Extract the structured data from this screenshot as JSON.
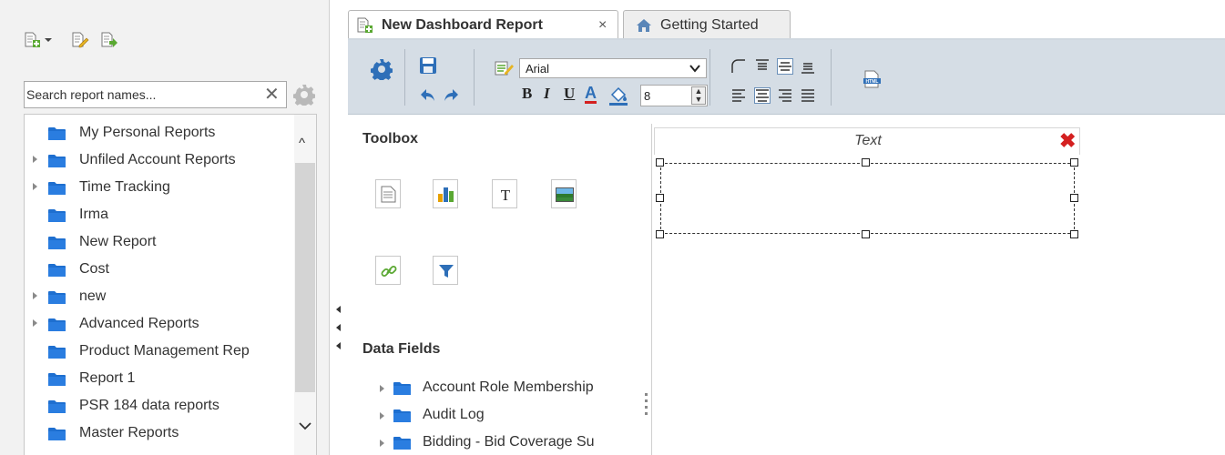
{
  "left_panel": {
    "search": {
      "placeholder": "Search report names...",
      "clear_glyph": "✕"
    },
    "toolbar_icons": [
      "new-report-icon",
      "edit-report-icon",
      "export-report-icon"
    ],
    "tree": [
      {
        "label": "My Personal Reports",
        "expandable": false
      },
      {
        "label": "Unfiled Account Reports",
        "expandable": true
      },
      {
        "label": "Time Tracking",
        "expandable": true
      },
      {
        "label": "Irma",
        "expandable": false
      },
      {
        "label": "New Report",
        "expandable": false
      },
      {
        "label": "Cost",
        "expandable": false
      },
      {
        "label": "new",
        "expandable": true
      },
      {
        "label": "Advanced Reports",
        "expandable": true
      },
      {
        "label": "Product Management Rep",
        "expandable": false
      },
      {
        "label": "Report 1",
        "expandable": false
      },
      {
        "label": "PSR 184 data reports",
        "expandable": false
      },
      {
        "label": "Master Reports",
        "expandable": false
      }
    ]
  },
  "tabs": [
    {
      "label": "New Dashboard Report",
      "close_glyph": "×",
      "active": true
    },
    {
      "label": "Getting Started",
      "active": false
    }
  ],
  "toolbar": {
    "font_family": "Arial",
    "font_size": "8",
    "bold": "B",
    "italic": "I",
    "underline": "U",
    "font_color": "A"
  },
  "toolbox": {
    "title": "Toolbox",
    "tools": [
      "report-icon",
      "chart-icon",
      "text-icon",
      "image-icon",
      "link-icon",
      "filter-icon"
    ]
  },
  "data_fields": {
    "title": "Data Fields",
    "items": [
      {
        "label": "Account Role Membership"
      },
      {
        "label": "Audit Log"
      },
      {
        "label": "Bidding - Bid Coverage Su"
      }
    ]
  },
  "canvas": {
    "widget_title": "Text",
    "close_glyph": "✖"
  },
  "colors": {
    "toolbar_bg": "#d5dde5",
    "folder_blue": "#1e6fd0",
    "close_red": "#d42020"
  }
}
